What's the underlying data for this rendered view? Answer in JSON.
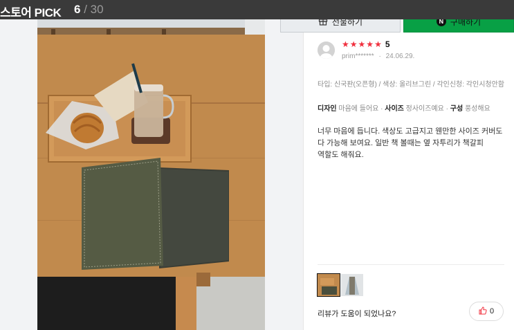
{
  "header": {
    "title": "스토어 PICK",
    "current": "6",
    "separator": "/",
    "total": "30"
  },
  "actions": {
    "gift_label": "선물하기",
    "buy_label": "구매하기",
    "buy_badge": "N"
  },
  "colors": {
    "topbar": "#3a3a3a",
    "buy_button": "#08a045",
    "star": "#f0303e",
    "panel_bg": "#f2f3f5"
  },
  "review": {
    "rating": 5,
    "rating_label": "5",
    "user": "prim*******",
    "date": "24.06.29.",
    "options": "타입: 신국판(오픈형) / 색상: 올리브그린 / 각인신청: 각인시청안함",
    "features": [
      {
        "key": "디자인",
        "value": "마음에 들어요"
      },
      {
        "key": "사이즈",
        "value": "정사이즈예요"
      },
      {
        "key": "구성",
        "value": "풍성해요"
      }
    ],
    "text": "너무 마음에 듭니다. 색상도 고급지고 웬만한 사이즈 커버도 다 가능해 보여요. 일반 책 볼때는 옆 자투리가 책갈피 역할도 해줘요.",
    "thumbnail_count": 2,
    "selected_thumbnail": 0,
    "helpful_question": "리뷰가 도움이 되었나요?",
    "like_count": "0"
  },
  "icons": {
    "gift": "gift-icon",
    "naver": "naver-n-icon",
    "thumbs_up": "thumbs-up-icon",
    "avatar": "default-avatar-icon"
  }
}
